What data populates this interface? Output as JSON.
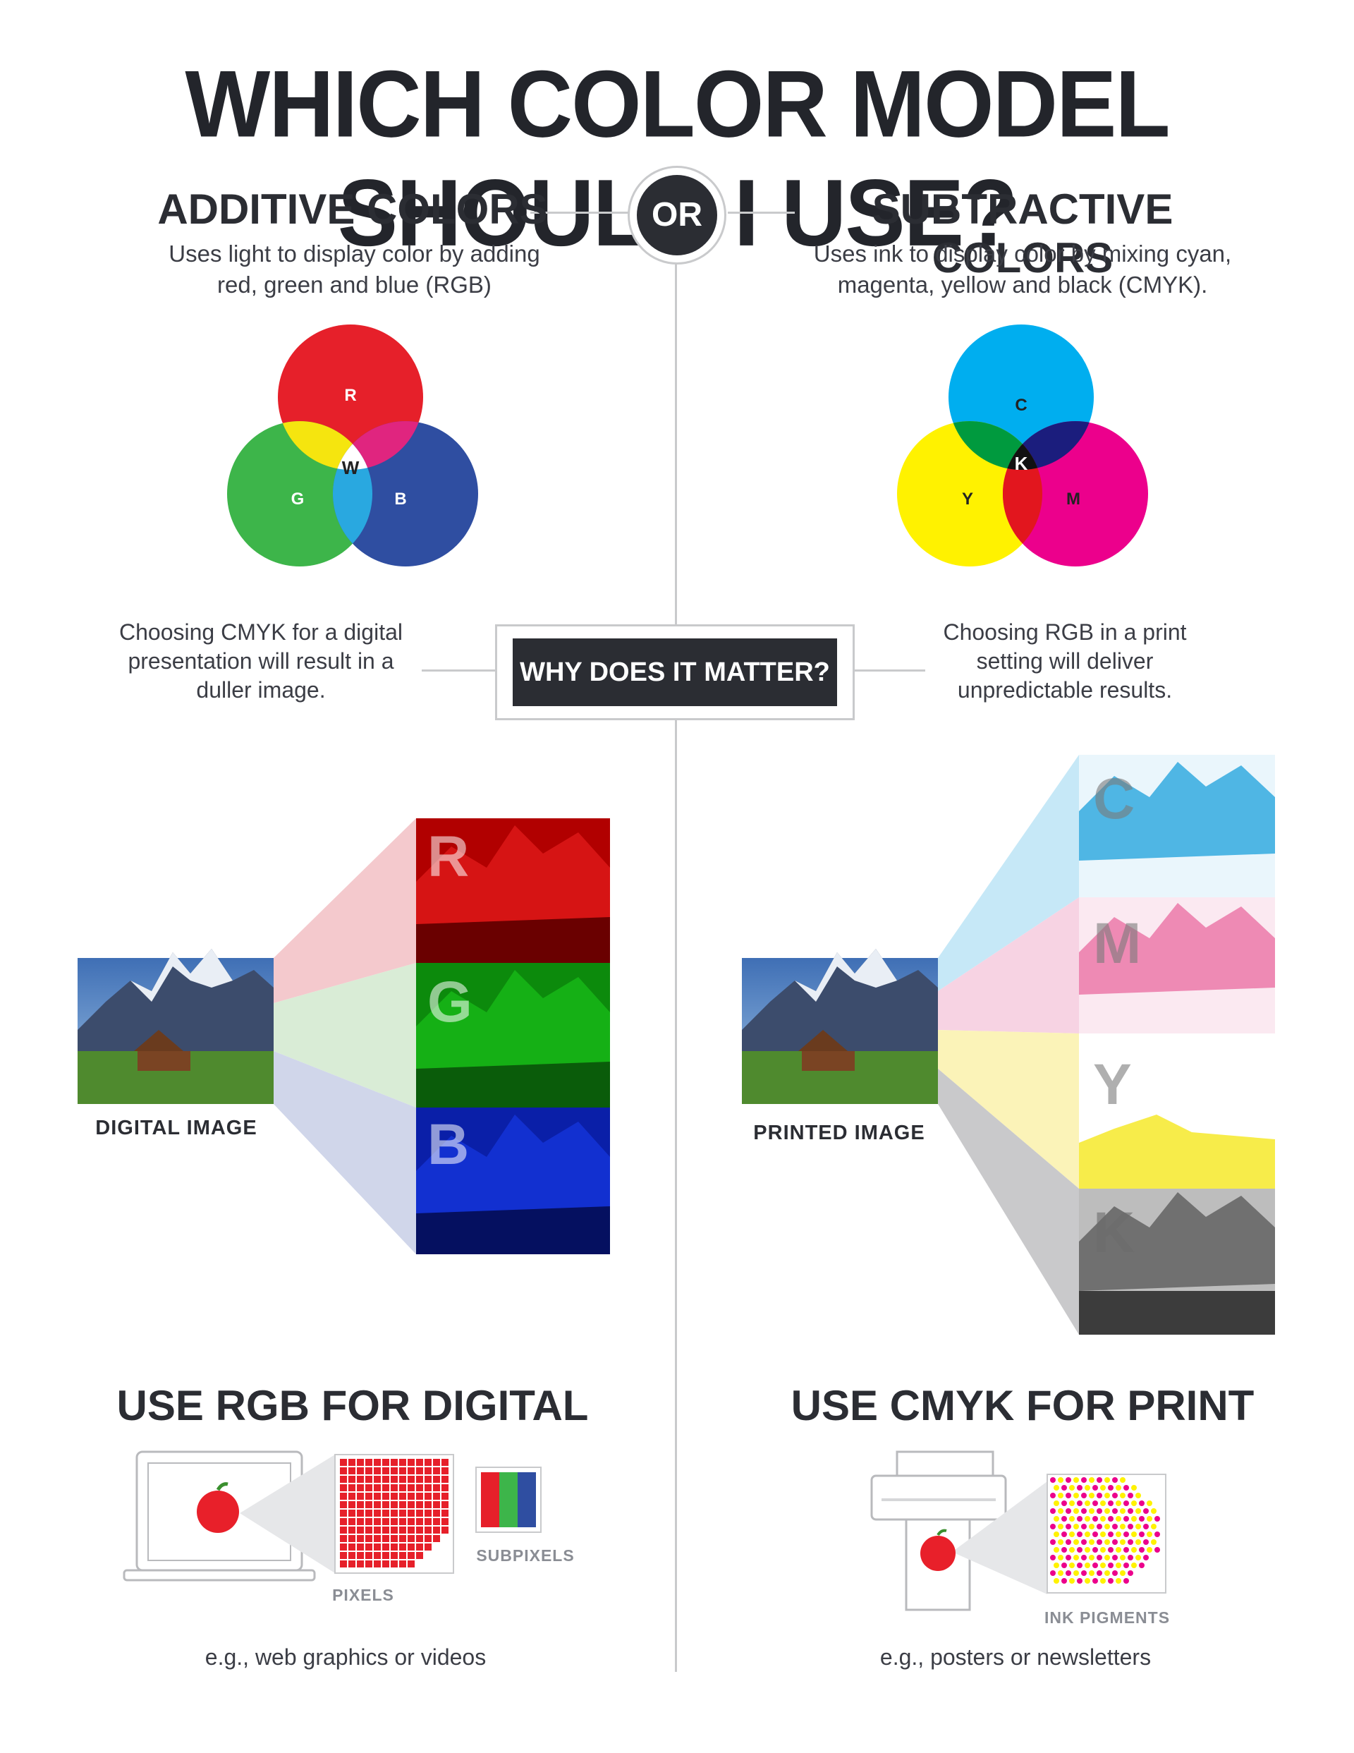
{
  "title": "WHICH COLOR MODEL SHOULD I USE?",
  "or_label": "OR",
  "additive": {
    "heading": "ADDITIVE COLORS",
    "description": "Uses light to display color by adding red, green and blue (RGB)",
    "letters": {
      "r": "R",
      "g": "G",
      "b": "B",
      "w": "W"
    },
    "colors": {
      "red": "#e6202a",
      "green": "#3db54a",
      "blue": "#2f4ea1",
      "yellow": "#f5e50f",
      "magenta": "#e0257f",
      "cyan": "#29a8e0",
      "white": "#ffffff"
    }
  },
  "subtractive": {
    "heading": "SUBTRACTIVE COLORS",
    "description": "Uses ink to display color by mixing cyan, magenta, yellow and black (CMYK).",
    "letters": {
      "c": "C",
      "m": "M",
      "y": "Y",
      "k": "K"
    },
    "colors": {
      "cyan": "#00aeef",
      "magenta": "#ec008c",
      "yellow": "#fff200",
      "green": "#009a3e",
      "blue": "#1b1d7d",
      "red": "#e2161e",
      "black": "#111111"
    }
  },
  "matter": {
    "label": "WHY DOES IT MATTER?",
    "left_text": "Choosing CMYK for a digital presentation will result in a duller image.",
    "right_text": "Choosing RGB in a print setting will deliver unpredictable results."
  },
  "digital": {
    "caption": "DIGITAL IMAGE",
    "channels": [
      "R",
      "G",
      "B"
    ]
  },
  "printed": {
    "caption": "PRINTED IMAGE",
    "channels": [
      "C",
      "M",
      "Y",
      "K"
    ]
  },
  "rgb_use": {
    "heading": "USE RGB FOR DIGITAL",
    "pixels_label": "PIXELS",
    "subpixels_label": "SUBPIXELS",
    "example": "e.g., web graphics or videos"
  },
  "cmyk_use": {
    "heading": "USE CMYK FOR PRINT",
    "ink_label": "INK PIGMENTS",
    "example": "e.g., posters or newsletters"
  }
}
